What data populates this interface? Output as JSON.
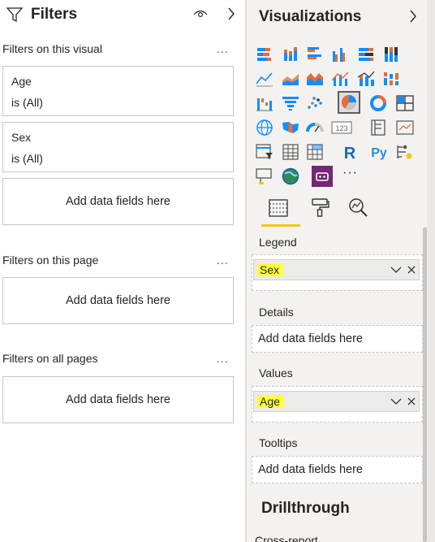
{
  "filters_pane": {
    "title": "Filters",
    "icons": {
      "title": "funnel-icon",
      "visibility": "eye-icon",
      "collapse": "chevron-right-icon"
    },
    "visual_section": {
      "label": "Filters on this visual",
      "more": "...",
      "cards": [
        {
          "field": "Age",
          "state": "is (All)"
        },
        {
          "field": "Sex",
          "state": "is (All)"
        }
      ],
      "drop_zone": "Add data fields here"
    },
    "page_section": {
      "label": "Filters on this page",
      "more": "...",
      "drop_zone": "Add data fields here"
    },
    "all_pages_section": {
      "label": "Filters on all pages",
      "more": "...",
      "drop_zone": "Add data fields here"
    }
  },
  "viz_pane": {
    "title": "Visualizations",
    "collapse_icon": "chevron-right-icon",
    "selected_visual": "pie-chart-icon",
    "visual_icons": [
      "stacked-bar-icon",
      "stacked-column-icon",
      "clustered-bar-icon",
      "clustered-column-icon",
      "100-stacked-bar-icon",
      "100-stacked-column-icon",
      "line-chart-icon",
      "area-chart-icon",
      "stacked-area-icon",
      "line-clustered-column-icon",
      "line-stacked-column-icon",
      "ribbon-chart-icon",
      "waterfall-icon",
      "funnel-icon",
      "scatter-icon",
      "pie-chart-icon",
      "donut-chart-icon",
      "treemap-icon",
      "map-icon",
      "filled-map-icon",
      "gauge-icon",
      "card-icon",
      "multi-row-card-icon",
      "kpi-icon",
      "slicer-icon",
      "table-icon",
      "matrix-icon",
      "r-visual-icon",
      "python-visual-icon",
      "key-influencers-icon",
      "decomposition-tree-icon",
      "arcgis-map-icon",
      "power-apps-icon",
      "more-visuals-icon"
    ],
    "more_visuals": "···",
    "tabs": [
      "fields-tab-icon",
      "format-tab-icon",
      "analytics-tab-icon"
    ],
    "wells": {
      "legend": {
        "label": "Legend",
        "field": "Sex"
      },
      "details": {
        "label": "Details",
        "placeholder": "Add data fields here"
      },
      "values": {
        "label": "Values",
        "field": "Age"
      },
      "tooltips": {
        "label": "Tooltips",
        "placeholder": "Add data fields here"
      }
    },
    "drillthrough": {
      "title": "Drillthrough",
      "cross_report": "Cross-report"
    }
  },
  "colors": {
    "highlight": "#FFFF40",
    "tab_underline": "#F2C811",
    "pane_bg": "#F3F2F1",
    "border": "#C8C6C4",
    "power_apps": "#742774"
  }
}
